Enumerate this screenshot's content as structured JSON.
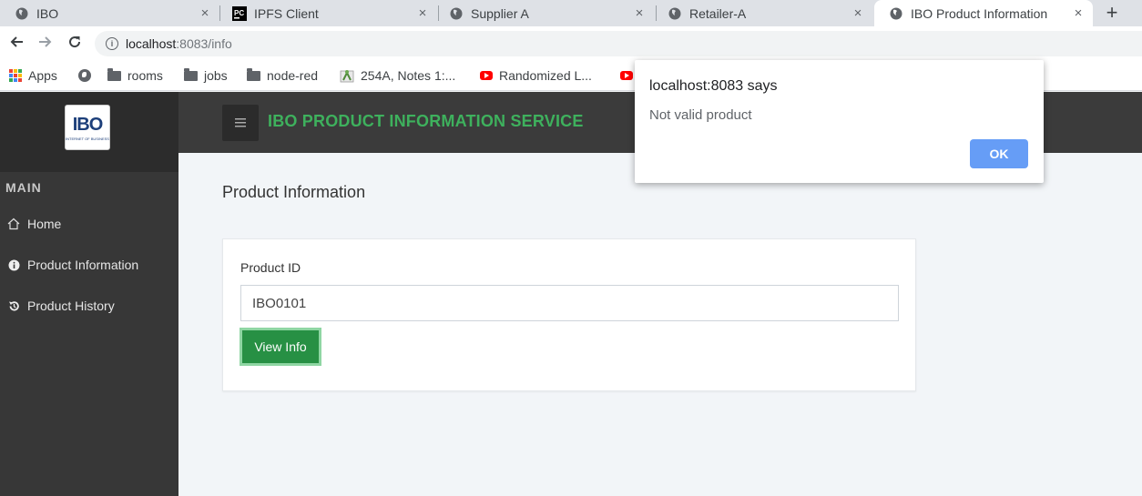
{
  "browser": {
    "tabs": [
      {
        "title": "IBO",
        "icon": "globe-icon"
      },
      {
        "title": "IPFS Client",
        "icon": "pycharm-icon"
      },
      {
        "title": "Supplier A",
        "icon": "globe-icon"
      },
      {
        "title": "Retailer-A",
        "icon": "globe-icon"
      },
      {
        "title": "IBO Product Information",
        "icon": "globe-icon",
        "active": true
      }
    ],
    "new_tab": "+",
    "close_glyph": "×",
    "address": {
      "host": "localhost",
      "path": ":8083/info"
    },
    "bookmarks": [
      {
        "label": "Apps",
        "icon": "apps-grid-icon"
      },
      {
        "label": "",
        "icon": "globe-icon"
      },
      {
        "label": "rooms",
        "icon": "folder-icon"
      },
      {
        "label": "jobs",
        "icon": "folder-icon"
      },
      {
        "label": "node-red",
        "icon": "folder-icon"
      },
      {
        "label": "254A, Notes 1:...",
        "icon": "plant-icon"
      },
      {
        "label": "Randomized L...",
        "icon": "youtube-icon"
      }
    ]
  },
  "app": {
    "logo_text": "IBO",
    "logo_subtext": "INTERNET OF BUSINESS",
    "menu_heading": "MAIN",
    "menu": [
      {
        "label": "Home",
        "icon": "home-icon"
      },
      {
        "label": "Product Information",
        "icon": "info-icon"
      },
      {
        "label": "Product History",
        "icon": "history-icon"
      }
    ],
    "service_title": "IBO PRODUCT INFORMATION SERVICE",
    "page_title": "Product Information",
    "form": {
      "label": "Product ID",
      "value": "IBO0101",
      "button": "View Info"
    }
  },
  "dialog": {
    "title": "localhost:8083 says",
    "message": "Not valid product",
    "ok": "OK"
  },
  "colors": {
    "accent_green": "#3eb15d",
    "button_green": "#279044",
    "sidebar": "#373737",
    "dialog_button": "#669df6"
  }
}
